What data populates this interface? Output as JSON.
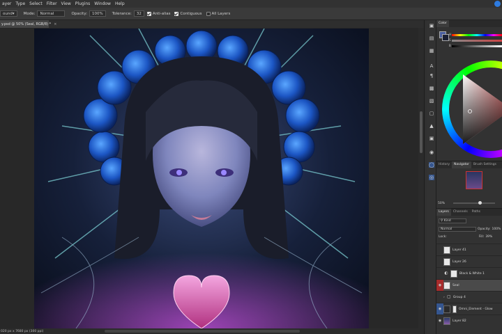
{
  "menubar": {
    "items": [
      "ayer",
      "Type",
      "Select",
      "Filter",
      "View",
      "Plugins",
      "Window",
      "Help"
    ]
  },
  "options": {
    "tool_preset": "ound",
    "mode_label": "Mode:",
    "mode_value": "Normal",
    "opacity_label": "Opacity:",
    "opacity_value": "100%",
    "tolerance_label": "Tolerance:",
    "tolerance_value": "32",
    "anti_alias": "Anti-alias",
    "contiguous": "Contiguous",
    "all_layers": "All Layers"
  },
  "document": {
    "tab_title": "y.psd @ 50% (Seal, RGB/8) *",
    "tab_close": "×"
  },
  "status": {
    "dimensions": "020 px x 7680 px (300 ppi)"
  },
  "panels": {
    "color_tab": "Color",
    "nav_tabs": [
      "History",
      "Navigator",
      "Brush Settings"
    ],
    "zoom_value": "50%",
    "layers_tabs": [
      "Layers",
      "Channels",
      "Paths"
    ],
    "kind_label": "Kind",
    "blend_mode": "Normal",
    "opacity_label": "Opacity:",
    "opacity_value": "100%",
    "lock_label": "Lock:",
    "fill_label": "Fill:",
    "fill_value": "39%",
    "slider_labels": [
      "H",
      "S",
      "B"
    ]
  },
  "layers": [
    {
      "name": "Layer 41"
    },
    {
      "name": "Layer 26"
    },
    {
      "name": "Black & White 1"
    },
    {
      "name": "Seal"
    },
    {
      "name": "Group 4"
    },
    {
      "name": "Omni_Element - Glow"
    },
    {
      "name": "Layer 82"
    }
  ],
  "colors": {
    "accent": "#2d7be0",
    "selected_eye": "#a62b2b"
  }
}
